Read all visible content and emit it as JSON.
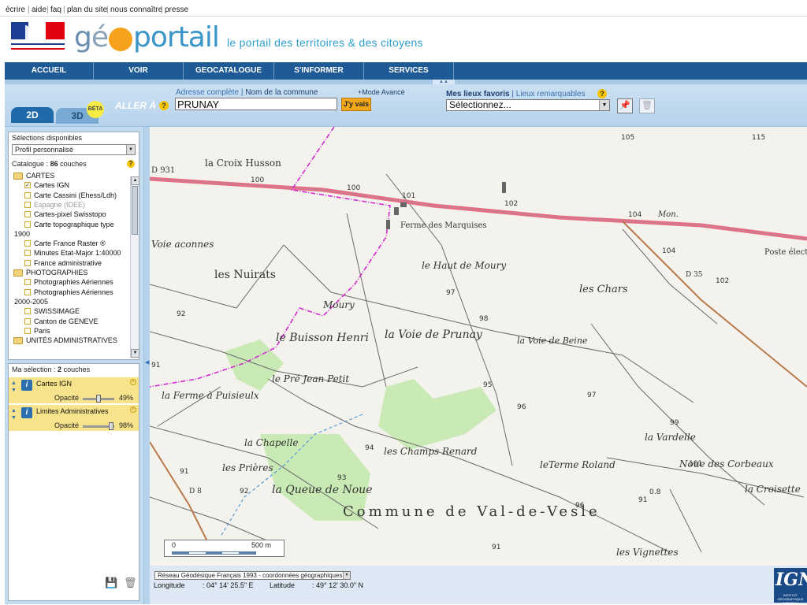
{
  "top_links": [
    "écrire",
    "aide",
    "faq",
    "plan du site",
    "nous connaître",
    "presse"
  ],
  "header": {
    "logo_text": "géoportail",
    "tagline": "le portail des territoires & des citoyens"
  },
  "nav": [
    "ACCUEIL",
    "VOIR",
    "GEOCATALOGUE",
    "S'INFORMER",
    "SERVICES"
  ],
  "toolbar": {
    "tab_2d": "2D",
    "tab_3d": "3D",
    "beta": "BÉTA",
    "aller_a": "ALLER À",
    "addr_label": "Adresse complète",
    "addr_label2": "Nom de la commune",
    "mode_avance": "+Mode Avancé",
    "search_value": "PRUNAY",
    "go_label": "J'y vais",
    "fav_label": "Mes lieux favoris",
    "fav_label2": "Lieux remarquables",
    "fav_select": "Sélectionnez..."
  },
  "sidebar": {
    "selections_label": "Sélections disponibles",
    "profile": "Profil personnalisé",
    "catalogue_text": "Catalogue :",
    "catalogue_count": "86",
    "catalogue_suffix": "couches",
    "tree": [
      {
        "type": "folder",
        "label": "CARTES"
      },
      {
        "type": "item",
        "label": "Cartes IGN",
        "checked": true
      },
      {
        "type": "item",
        "label": "Carte Cassini (Ehess/Ldh)"
      },
      {
        "type": "item",
        "label": "Espagne (IDEE)",
        "gray": true
      },
      {
        "type": "item",
        "label": "Cartes-pixel Swisstopo"
      },
      {
        "type": "item",
        "label": "Carte topographique type"
      },
      {
        "type": "cont",
        "label": "1900"
      },
      {
        "type": "item",
        "label": "Carte France Raster ®"
      },
      {
        "type": "item",
        "label": "Minutes Etat-Major 1:40000"
      },
      {
        "type": "item",
        "label": "France administrative"
      },
      {
        "type": "folder",
        "label": "PHOTOGRAPHIES"
      },
      {
        "type": "item",
        "label": "Photographies Aériennes"
      },
      {
        "type": "item",
        "label": "Photographies Aériennes"
      },
      {
        "type": "cont",
        "label": "2000-2005"
      },
      {
        "type": "item",
        "label": "SWISSIMAGE"
      },
      {
        "type": "item",
        "label": "Canton de GENEVE"
      },
      {
        "type": "item",
        "label": "Paris"
      },
      {
        "type": "folder",
        "label": "UNITÉS ADMINISTRATIVES"
      }
    ],
    "my_selection_text": "Ma sélection :",
    "my_selection_count": "2",
    "my_selection_suffix": "couches",
    "layers": [
      {
        "name": "Cartes IGN",
        "opacity_label": "Opacité",
        "opacity": "49%",
        "opacity_value": 0.49
      },
      {
        "name": "Limites Administratives",
        "opacity_label": "Opacité",
        "opacity": "98%",
        "opacity_value": 0.98
      }
    ]
  },
  "map": {
    "scale_start": "0",
    "scale_end": "500 m",
    "labels": [
      "la Croix Husson",
      "Ferme des Marquises",
      "le Haut de Moury",
      "les Nuirats",
      "Moury",
      "les Chars",
      "le Buisson Henri",
      "la Voie de Prunay",
      "la Voie de Beine",
      "le Pré Jean Petit",
      "la Ferme à Puisieulx",
      "la Chapelle",
      "les Champs Renard",
      "leTerme Roland",
      "la Vardelle",
      "Noue des Corbeaux",
      "les Prières",
      "la Queue de Noue",
      "la Croisette",
      "Commune de Val-de-Vesle",
      "les Vignettes",
      "Voie aconnes",
      "Poste électrique",
      "Mon.",
      "D 35",
      "D 8",
      "D 931"
    ],
    "elevations": [
      "100",
      "100",
      "101",
      "102",
      "104",
      "104",
      "105",
      "115",
      "97",
      "98",
      "92",
      "91",
      "95",
      "96",
      "97",
      "94",
      "93",
      "92",
      "91",
      "99",
      "101",
      "102",
      "96",
      "0.8",
      "91",
      "91"
    ]
  },
  "infobar": {
    "crs": "Réseau Géodésique Français 1993 - coordonnées géographiques",
    "longitude_label": "Longitude",
    "longitude_value": ": 04° 14' 25.5\" E",
    "latitude_label": "Latitude",
    "latitude_value": ": 49° 12' 30.0\" N",
    "ign": "IGN",
    "ign_sub": "INSTITUT GÉOGRAPHIQUE NATIONAL"
  }
}
